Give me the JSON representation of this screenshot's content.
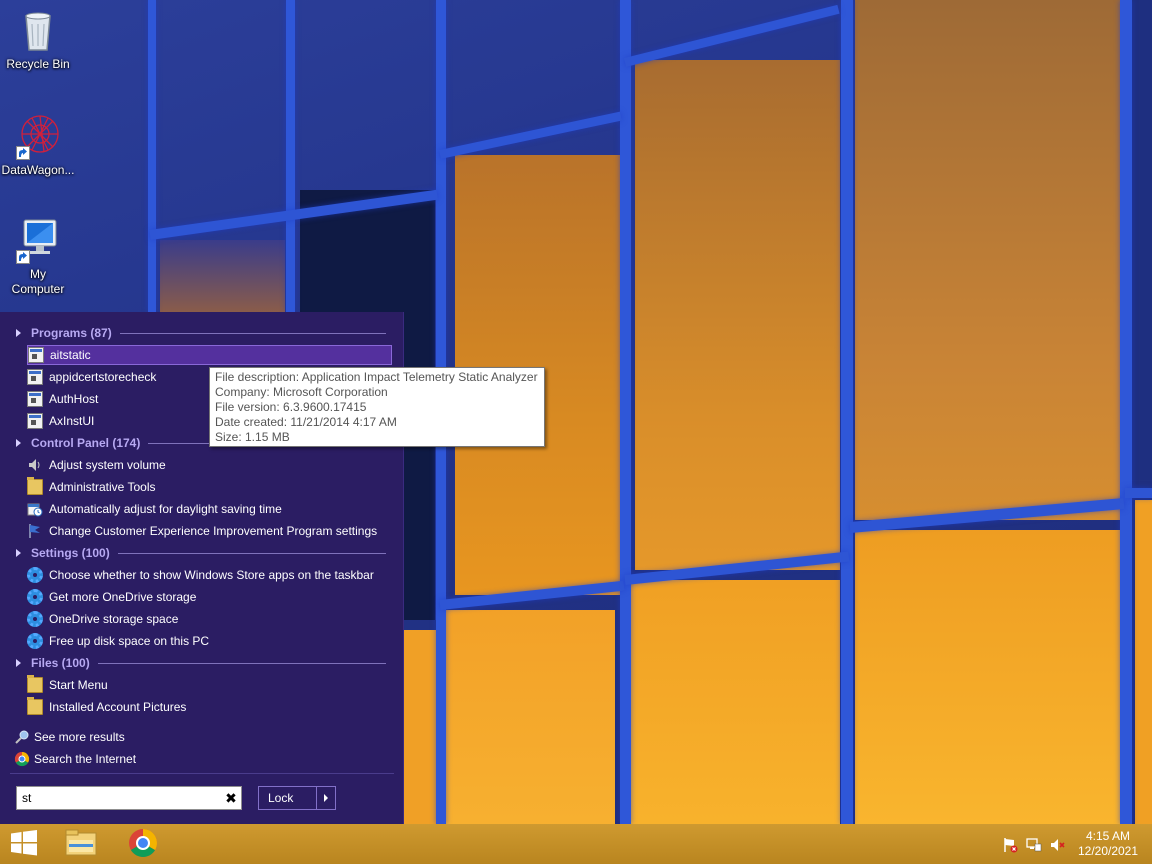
{
  "desktop": {
    "icons": [
      {
        "label": "Recycle Bin",
        "icon": "recycle-bin-icon"
      },
      {
        "label": "DataWagon...",
        "icon": "datawagon-icon"
      },
      {
        "label": "My Computer",
        "icon": "my-computer-icon"
      }
    ]
  },
  "start_menu": {
    "sections": {
      "programs": {
        "title": "Programs (87)",
        "items": [
          {
            "label": "aitstatic",
            "icon": "app-icon",
            "selected": true
          },
          {
            "label": "appidcertstorecheck",
            "icon": "app-icon"
          },
          {
            "label": "AuthHost",
            "icon": "app-icon"
          },
          {
            "label": "AxInstUI",
            "icon": "app-icon"
          }
        ]
      },
      "control_panel": {
        "title": "Control Panel (174)",
        "items": [
          {
            "label": "Adjust system volume",
            "icon": "speaker-icon"
          },
          {
            "label": "Administrative Tools",
            "icon": "folder-icon"
          },
          {
            "label": "Automatically adjust for daylight saving time",
            "icon": "clock-calendar-icon"
          },
          {
            "label": "Change Customer Experience Improvement Program settings",
            "icon": "flag-icon"
          }
        ]
      },
      "settings": {
        "title": "Settings (100)",
        "items": [
          {
            "label": "Choose whether to show Windows Store apps on the taskbar",
            "icon": "gear-icon"
          },
          {
            "label": "Get more OneDrive storage",
            "icon": "gear-icon"
          },
          {
            "label": "OneDrive storage space",
            "icon": "gear-icon"
          },
          {
            "label": "Free up disk space on this PC",
            "icon": "gear-icon"
          }
        ]
      },
      "files": {
        "title": "Files (100)",
        "items": [
          {
            "label": "Start Menu",
            "icon": "folder-icon"
          },
          {
            "label": "Installed Account Pictures",
            "icon": "folder-icon"
          }
        ]
      }
    },
    "footer": {
      "see_more": "See more results",
      "search_internet": "Search the Internet"
    },
    "search": {
      "value": "st",
      "clear_glyph": "✖"
    },
    "lock_label": "Lock"
  },
  "tooltip": {
    "line1": "File description: Application Impact Telemetry Static Analyzer",
    "line2": "Company: Microsoft Corporation",
    "line3": "File version: 6.3.9600.17415",
    "line4": "Date created: 11/21/2014 4:17 AM",
    "line5": "Size: 1.15 MB"
  },
  "taskbar": {
    "pinned": [
      "start-button",
      "file-explorer-icon",
      "chrome-icon"
    ],
    "tray": [
      "action-center-flag-icon",
      "network-icon",
      "volume-muted-icon"
    ],
    "clock": {
      "time": "4:15 AM",
      "date": "12/20/2021"
    }
  },
  "colors": {
    "start_menu_bg": "#2b1d63",
    "section_header": "#b7a9f2",
    "selection": "#54309e",
    "taskbar": "#c38f2a",
    "wallpaper_frame": "#2f57d8",
    "wallpaper_glass": "#f0a028"
  }
}
